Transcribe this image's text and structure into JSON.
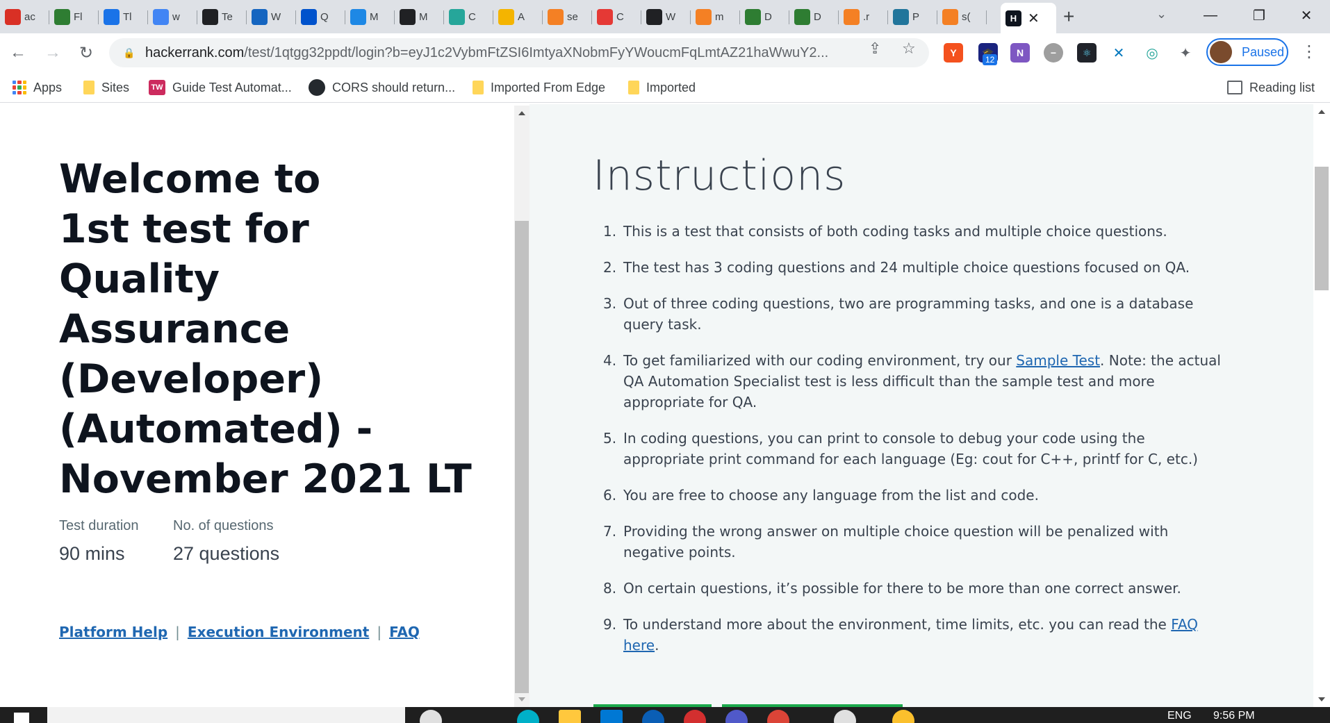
{
  "browser": {
    "tabs": [
      {
        "title": "ac",
        "icon": "puzzle-icon",
        "color": "#d93025"
      },
      {
        "title": "Fl",
        "icon": "image-icon",
        "color": "#2e7d32"
      },
      {
        "title": "Tl",
        "icon": "gear-outline-icon",
        "color": "#1a73e8"
      },
      {
        "title": "w",
        "icon": "google-icon",
        "color": "#4285f4"
      },
      {
        "title": "Te",
        "icon": "settings-icon",
        "color": "#202124"
      },
      {
        "title": "W",
        "icon": "calendar-icon",
        "color": "#1565c0"
      },
      {
        "title": "Q",
        "icon": "atlassian-icon",
        "color": "#0052cc"
      },
      {
        "title": "M",
        "icon": "m-logo-icon",
        "color": "#1e88e5"
      },
      {
        "title": "M",
        "icon": "x-logo-icon",
        "color": "#202124"
      },
      {
        "title": "C",
        "icon": "shield-icon",
        "color": "#26a69a"
      },
      {
        "title": "A",
        "icon": "chrome-icon",
        "color": "#f4b400"
      },
      {
        "title": "se",
        "icon": "stack-icon",
        "color": "#f48024"
      },
      {
        "title": "C",
        "icon": "layers-icon",
        "color": "#e53935"
      },
      {
        "title": "W",
        "icon": "link-icon",
        "color": "#202124"
      },
      {
        "title": "m",
        "icon": "stack-icon",
        "color": "#f48024"
      },
      {
        "title": "D",
        "icon": "infinity-icon",
        "color": "#2e7d32"
      },
      {
        "title": "D",
        "icon": "infinity-icon",
        "color": "#2e7d32"
      },
      {
        "title": ".r",
        "icon": "stack-icon",
        "color": "#f48024"
      },
      {
        "title": "P",
        "icon": "wordpress-icon",
        "color": "#21759b"
      },
      {
        "title": "s(",
        "icon": "stack-icon",
        "color": "#f48024"
      }
    ],
    "active_tab": {
      "icon_text": "H",
      "title": ""
    },
    "url_host": "hackerrank.com",
    "url_path": "/test/1qtgg32ppdt/login?b=eyJ1c2VybmFtZSI6ImtyaXNobmFyYWoucmFqLmtAZ21haWwuY2...",
    "profile_label": "Paused",
    "extension_badge": "12",
    "bookmarks": [
      {
        "label": "Apps",
        "type": "apps"
      },
      {
        "label": "Sites",
        "type": "folder"
      },
      {
        "label": "Guide Test Automat...",
        "type": "tw"
      },
      {
        "label": "CORS should return...",
        "type": "github"
      },
      {
        "label": "Imported From Edge",
        "type": "folder"
      },
      {
        "label": "Imported",
        "type": "folder"
      }
    ],
    "reading_list": "Reading list"
  },
  "left": {
    "heading_lines": [
      "Welcome to",
      "1st test for Quality",
      "Assurance",
      "(Developer)",
      "(Automated) -",
      "November 2021 LT"
    ],
    "duration_label": "Test duration",
    "duration_value": "90 mins",
    "questions_label": "No. of questions",
    "questions_value": "27 questions",
    "links": [
      "Platform Help",
      "Execution Environment",
      "FAQ"
    ]
  },
  "instructions": {
    "title": "Instructions",
    "items": [
      {
        "num": "1.",
        "text": "This is a test that consists of both coding tasks and multiple choice questions."
      },
      {
        "num": "2.",
        "text": "The test has 3 coding questions and 24 multiple choice questions focused on QA."
      },
      {
        "num": "3.",
        "text": "Out of three coding questions, two are programming tasks, and one is a database query task."
      },
      {
        "num": "4.",
        "pre": "To get familiarized with our coding environment, try our ",
        "link": "Sample Test",
        "post": ". Note: the actual QA Automation Specialist test is less difficult than the sample test and more appropriate for QA."
      },
      {
        "num": "5.",
        "text": "In coding questions, you can print to console to debug your code using the appropriate print command for each language (Eg: cout for C++, printf for C, etc.)"
      },
      {
        "num": "6.",
        "text": "You are free to choose any language from the list and code."
      },
      {
        "num": "7.",
        "text": "Providing the wrong answer on multiple choice question will be penalized with negative points."
      },
      {
        "num": "8.",
        "text": "On certain questions, it’s possible for there to be more than one correct answer."
      },
      {
        "num": "9.",
        "pre": "To understand more about the environment, time limits, etc. you can read the ",
        "link": "FAQ here",
        "post": "."
      }
    ]
  },
  "taskbar": {
    "language": "ENG",
    "time": "9:56 PM"
  },
  "colors": {
    "link": "#1f67b1",
    "heading": "#0e141e",
    "panel_bg": "#f3f7f7",
    "accent_green": "#1ba94c"
  }
}
